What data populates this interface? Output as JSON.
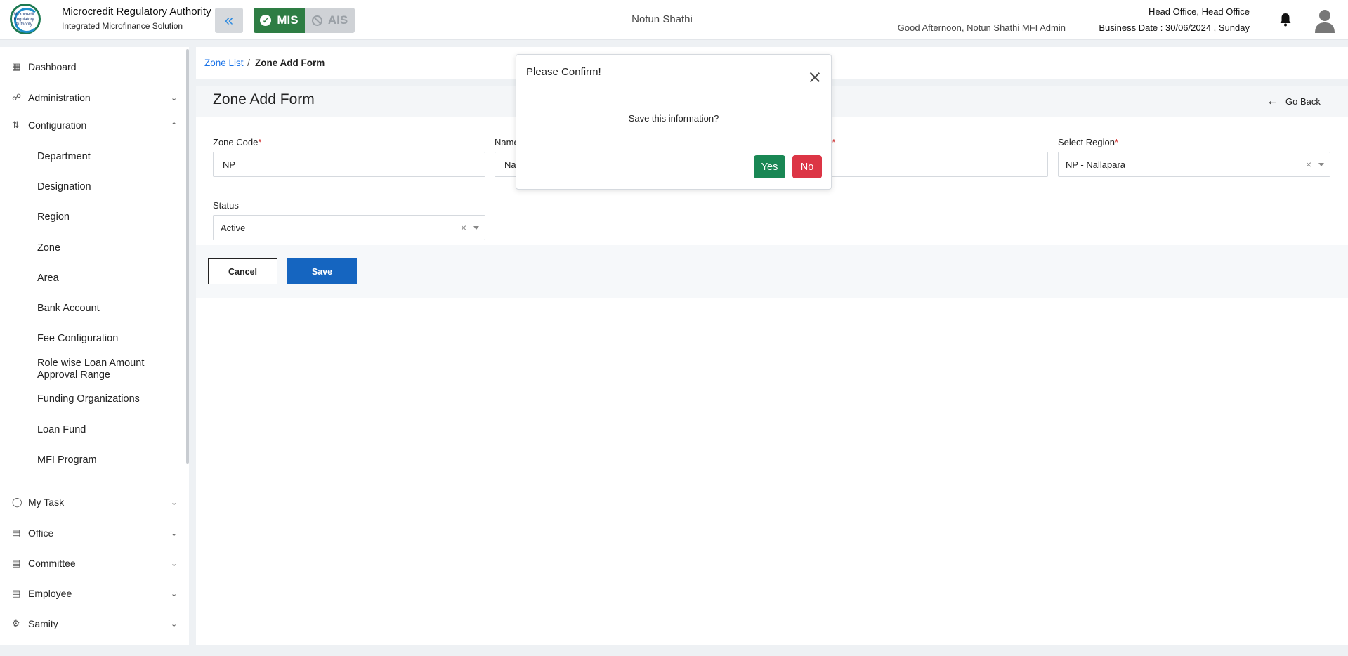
{
  "header": {
    "logo_text": "Microcredit Regulatory Authority",
    "org_name": "Microcredit Regulatory Authority",
    "org_subtitle": "Integrated Microfinance Solution",
    "mis_label": "MIS",
    "ais_label": "AIS",
    "center_title": "Notun Shathi",
    "greeting": "Good Afternoon, Notun Shathi MFI Admin",
    "office": "Head Office, Head Office",
    "business_date": "Business Date : 30/06/2024 , Sunday",
    "accent_green": "#2e7d44",
    "accent_blue": "#2f8be0"
  },
  "sidebar": {
    "items": [
      {
        "label": "Dashboard",
        "icon": "grid-icon"
      },
      {
        "label": "Administration",
        "icon": "network-icon"
      },
      {
        "label": "Configuration",
        "icon": "sliders-icon"
      }
    ],
    "config_sub": [
      "Department",
      "Designation",
      "Region",
      "Zone",
      "Area",
      "Bank Account",
      "Fee Configuration",
      "Role wise Loan Amount Approval Range",
      "Funding Organizations",
      "Loan Fund",
      "MFI Program"
    ],
    "bottom_items": [
      {
        "label": "My Task",
        "icon": "task-icon"
      },
      {
        "label": "Office",
        "icon": "office-icon"
      },
      {
        "label": "Committee",
        "icon": "committee-icon"
      },
      {
        "label": "Employee",
        "icon": "employee-icon"
      },
      {
        "label": "Samity",
        "icon": "samity-icon"
      }
    ]
  },
  "breadcrumb": {
    "link": "Zone List",
    "separator": "/",
    "current": "Zone Add Form"
  },
  "form": {
    "title": "Zone Add Form",
    "go_back": "Go Back",
    "zone_code_label": "Zone Code",
    "zone_code_value": "NP",
    "name_label": "Name",
    "name_value": "Na",
    "third_label_suffix": ")",
    "region_label": "Select Region",
    "region_value": "NP - Nallapara",
    "status_label": "Status",
    "status_value": "Active",
    "required_mark": "*",
    "clear_symbol": "×",
    "cancel_label": "Cancel",
    "save_label": "Save"
  },
  "modal": {
    "title": "Please Confirm!",
    "message": "Save this information?",
    "yes_label": "Yes",
    "no_label": "No"
  }
}
